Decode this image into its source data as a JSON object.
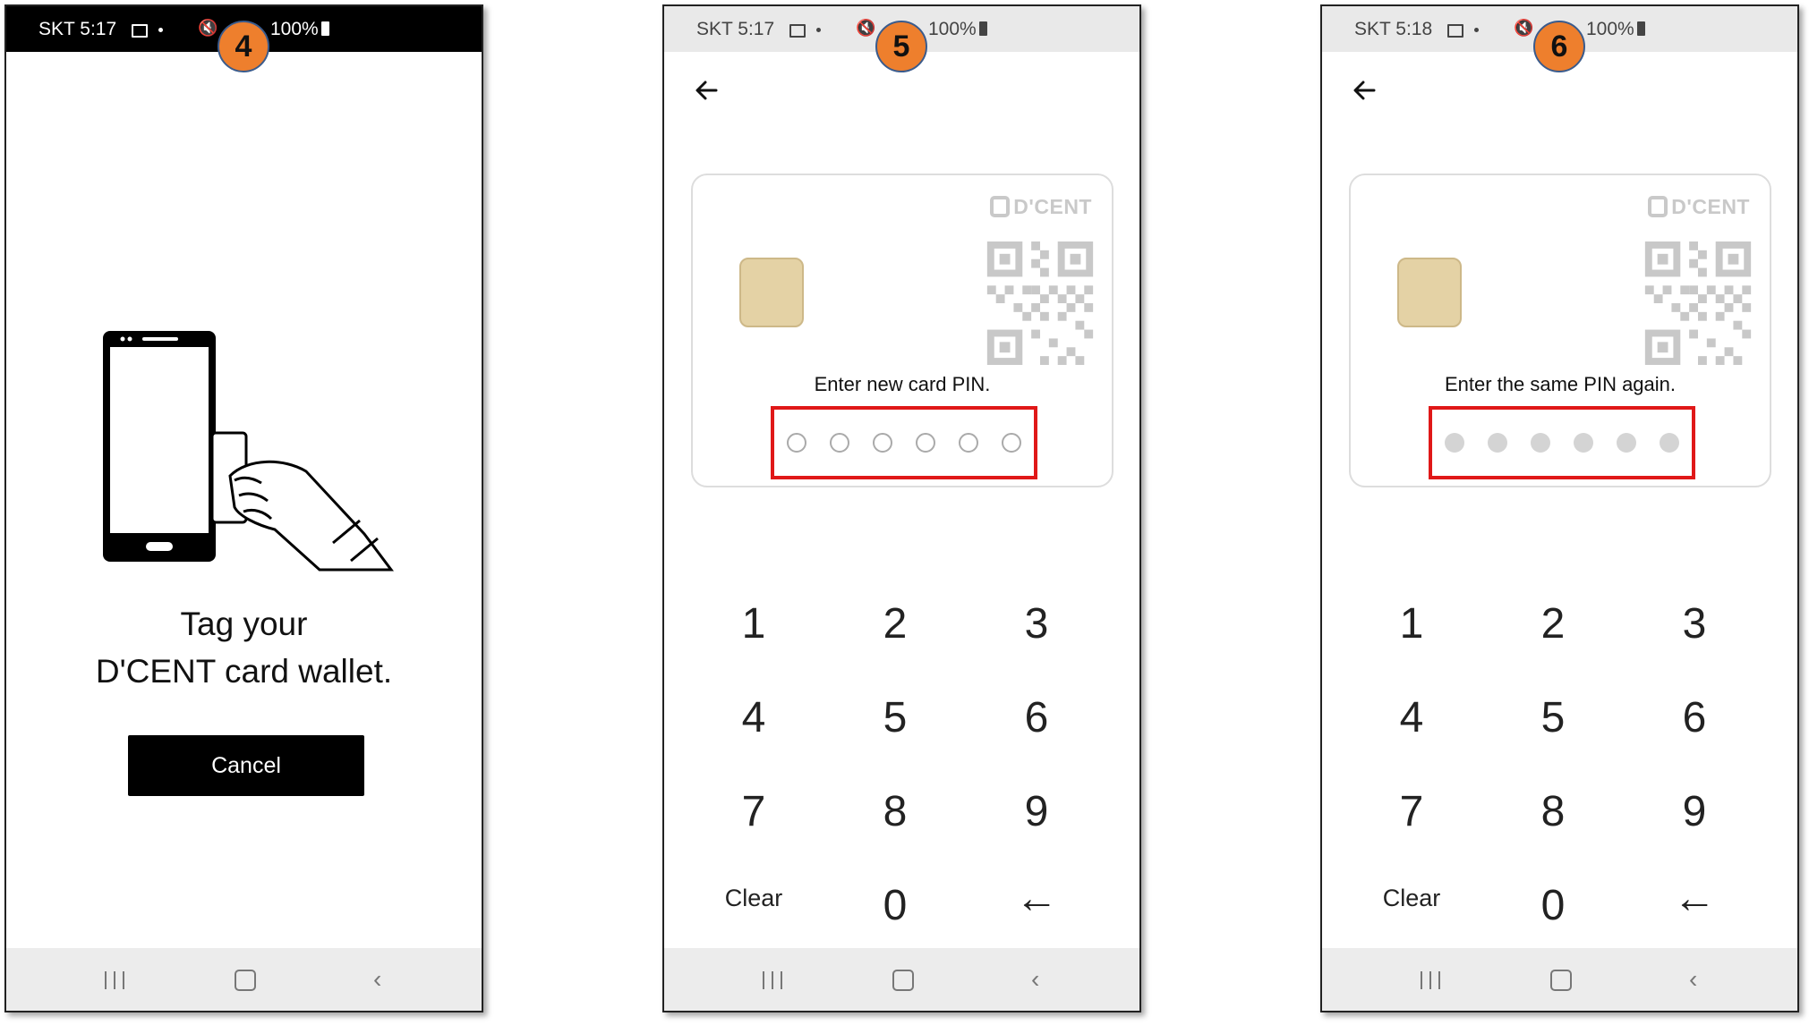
{
  "screens": [
    {
      "step": "4",
      "status": {
        "carrier": "SKT 5:17",
        "battery": "100%"
      },
      "tag_line1": "Tag your",
      "tag_line2": "D'CENT card wallet.",
      "cancel_label": "Cancel"
    },
    {
      "step": "5",
      "status": {
        "carrier": "SKT 5:17",
        "battery": "100%"
      },
      "card_logo": "D'CENT",
      "pin_prompt": "Enter new card PIN.",
      "pin_filled": 0,
      "pin_length": 6
    },
    {
      "step": "6",
      "status": {
        "carrier": "SKT 5:18",
        "battery": "100%"
      },
      "card_logo": "D'CENT",
      "pin_prompt": "Enter the same PIN again.",
      "pin_filled": 6,
      "pin_length": 6
    }
  ],
  "keypad": {
    "keys": [
      "1",
      "2",
      "3",
      "4",
      "5",
      "6",
      "7",
      "8",
      "9",
      "Clear",
      "0",
      "←"
    ]
  },
  "colors": {
    "badge": "#ee7f2d",
    "highlight_border": "#e01818"
  },
  "icons": [
    "image-icon",
    "mute-icon",
    "battery-icon",
    "back-arrow-icon",
    "chip-icon",
    "qr-code-icon",
    "nav-recent-icon",
    "nav-home-icon",
    "nav-back-icon"
  ]
}
